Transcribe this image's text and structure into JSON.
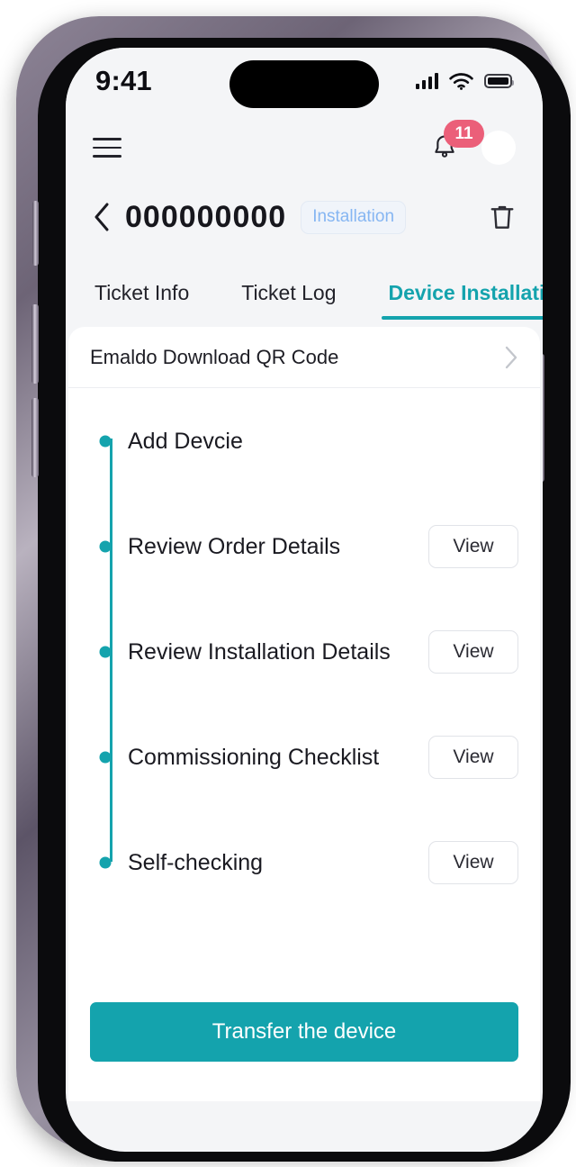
{
  "status_bar": {
    "time": "9:41",
    "signal_icon": "cellular-signal-icon",
    "wifi_icon": "wifi-icon",
    "battery_icon": "battery-full-icon"
  },
  "app_bar": {
    "menu_icon": "hamburger-menu-icon",
    "bell_icon": "notification-bell-icon",
    "notification_count": "11",
    "avatar_label": ""
  },
  "header": {
    "back_icon": "chevron-left-icon",
    "title": "000000000",
    "status_badge": "Installation",
    "delete_icon": "trash-icon"
  },
  "tabs": [
    {
      "label": "Ticket Info",
      "active": false
    },
    {
      "label": "Ticket Log",
      "active": false
    },
    {
      "label": "Device Installation",
      "active": true
    }
  ],
  "qr_row": {
    "label": "Emaldo Download QR Code",
    "chevron_icon": "chevron-right-icon"
  },
  "timeline": {
    "steps": [
      {
        "label": "Add Devcie",
        "action": ""
      },
      {
        "label": "Review Order Details",
        "action": "View"
      },
      {
        "label": "Review Installation Details",
        "action": "View"
      },
      {
        "label": "Commissioning Checklist",
        "action": "View"
      },
      {
        "label": "Self-checking",
        "action": "View"
      }
    ]
  },
  "footer": {
    "primary_action": "Transfer the device"
  },
  "colors": {
    "accent_teal": "#14a3ad",
    "badge_pink": "#eb5f79",
    "pill_blue": "#86b6f2",
    "page_bg": "#f4f5f7",
    "card_bg": "#ffffff"
  }
}
